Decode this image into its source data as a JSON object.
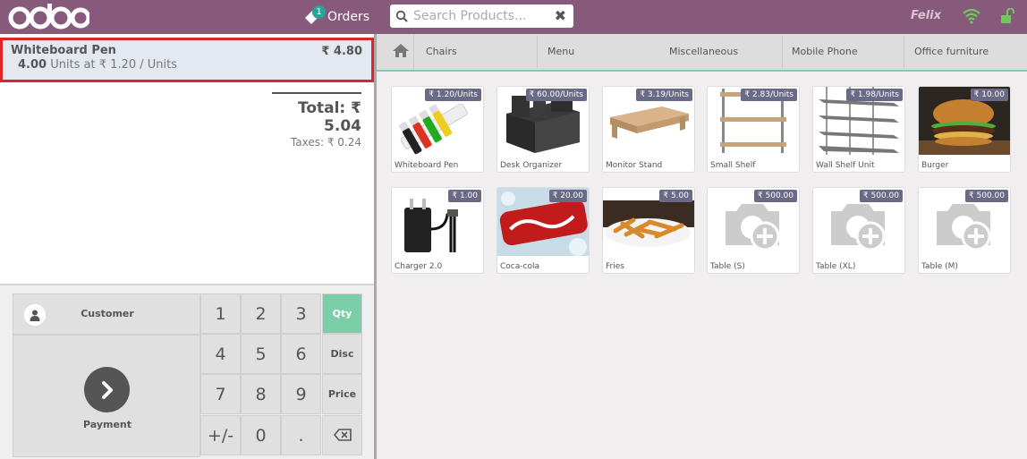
{
  "header": {
    "logo": "odoo",
    "orders_label": "Orders",
    "orders_count": "1",
    "search_placeholder": "Search Products...",
    "cashier": "Felix"
  },
  "order": {
    "line": {
      "product": "Whiteboard Pen",
      "price": "₹ 4.80",
      "quantity": "4.00",
      "unit_info": "Units at ₹ 1.20 / Units"
    },
    "total_label": "Total:",
    "total_value": "₹ 5.04",
    "taxes_label": "Taxes:",
    "taxes_value": "₹ 0.24"
  },
  "actionpad": {
    "customer_label": "Customer",
    "payment_label": "Payment"
  },
  "numpad": {
    "keys": [
      "1",
      "2",
      "3",
      "4",
      "5",
      "6",
      "7",
      "8",
      "9",
      "+/-",
      "0",
      "."
    ],
    "mode_qty": "Qty",
    "mode_disc": "Disc",
    "mode_price": "Price",
    "active_mode": "Qty"
  },
  "categories": [
    "Chairs",
    "Menu",
    "Miscellaneous",
    "Mobile Phone",
    "Office furniture"
  ],
  "products": [
    {
      "name": "Whiteboard Pen",
      "price": "₹ 1.20/Units"
    },
    {
      "name": "Desk Organizer",
      "price": "₹ 60.00/Units"
    },
    {
      "name": "Monitor Stand",
      "price": "₹ 3.19/Units"
    },
    {
      "name": "Small Shelf",
      "price": "₹ 2.83/Units"
    },
    {
      "name": "Wall Shelf Unit",
      "price": "₹ 1.98/Units"
    },
    {
      "name": "Burger",
      "price": "₹ 10.00"
    },
    {
      "name": "Charger 2.0",
      "price": "₹ 1.00"
    },
    {
      "name": "Coca-cola",
      "price": "₹ 20.00"
    },
    {
      "name": "Fries",
      "price": "₹ 5.00"
    },
    {
      "name": "Table (S)",
      "price": "₹ 500.00"
    },
    {
      "name": "Table (XL)",
      "price": "₹ 500.00"
    },
    {
      "name": "Table (M)",
      "price": "₹ 500.00"
    }
  ],
  "colors": {
    "brand": "#875a7b",
    "accent": "#7acea8",
    "badge": "#26a69a",
    "price_tag": "#6a6a86",
    "selection_border": "#e0252a"
  },
  "icons": [
    "tag-icon",
    "search-icon",
    "close-icon",
    "wifi-icon",
    "lock-icon",
    "home-icon",
    "user-icon",
    "chevron-right-icon",
    "backspace-icon"
  ]
}
